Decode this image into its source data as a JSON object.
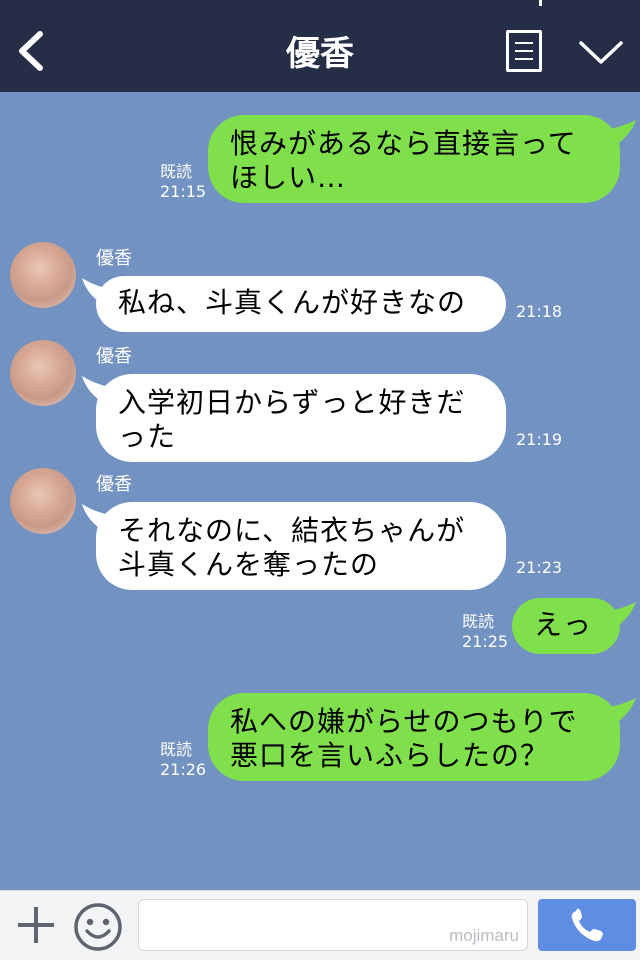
{
  "header": {
    "title": "優香",
    "back_icon": "chevron-left-icon",
    "menu_icon": "menu-icon",
    "collapse_icon": "chevron-down-icon",
    "bg_color": "#262e47"
  },
  "chat": {
    "bg_color": "#7292c1",
    "outgoing_color": "#80e04c",
    "incoming_color": "#ffffff",
    "messages": [
      {
        "dir": "out",
        "lines": [
          "恨みがあるなら直接言って",
          "ほしい…"
        ],
        "read": "既読",
        "time": "21:15"
      },
      {
        "dir": "in",
        "sender": "優香",
        "lines": [
          "私ね、斗真くんが好きなの"
        ],
        "time": "21:18"
      },
      {
        "dir": "in",
        "sender": "優香",
        "lines": [
          "入学初日からずっと好きだ",
          "った"
        ],
        "time": "21:19"
      },
      {
        "dir": "in",
        "sender": "優香",
        "lines": [
          "それなのに、結衣ちゃんが",
          "斗真くんを奪ったの"
        ],
        "time": "21:23"
      },
      {
        "dir": "out",
        "lines": [
          "えっ"
        ],
        "read": "既読",
        "time": "21:25"
      },
      {
        "dir": "out",
        "lines": [
          "私への嫌がらせのつもりで",
          "悪口を言いふらしたの？"
        ],
        "read": "既読",
        "time": "21:26"
      }
    ]
  },
  "input_bar": {
    "plus_icon": "plus-icon",
    "emoji_icon": "smile-icon",
    "watermark": "mojimaru",
    "call_icon": "phone-icon",
    "call_color": "#5f8de3"
  }
}
